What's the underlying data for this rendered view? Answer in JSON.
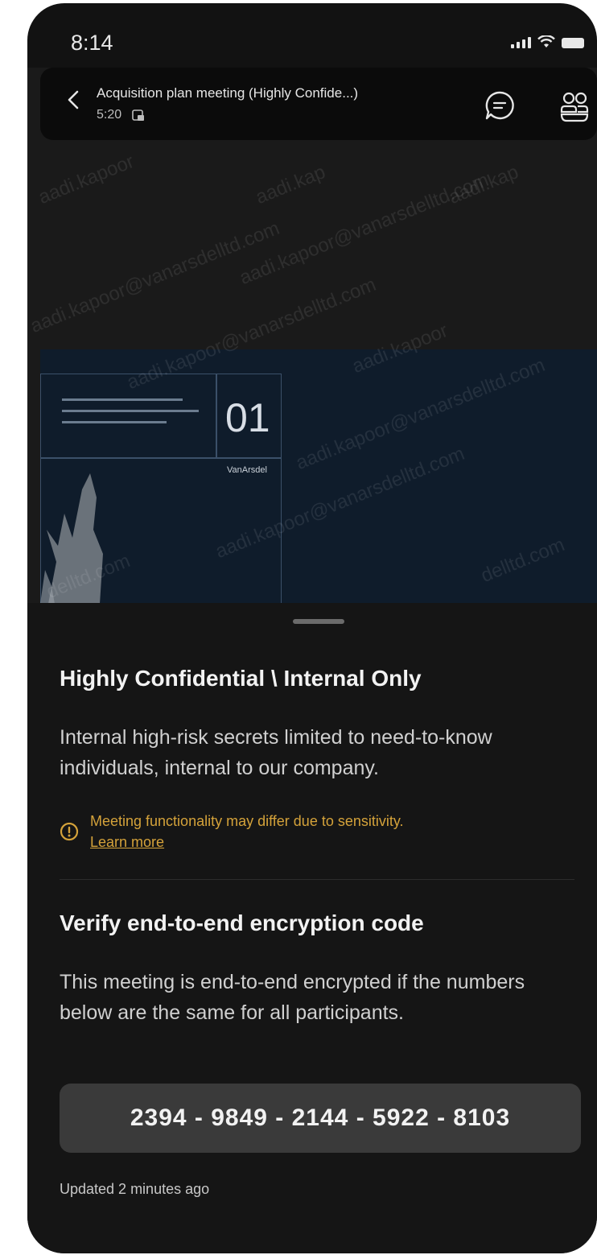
{
  "status": {
    "time": "8:14"
  },
  "header": {
    "title": "Acquisition plan meeting (Highly Confide...)",
    "duration": "5:20"
  },
  "watermark": {
    "email": "aadi.kapoor@vanarsdelltd.com",
    "fragments": [
      "aadi.kapoor",
      "aadi.kap",
      "@vanarsdelltd.com",
      "aadi.kapoor@vanarsdelltd.com",
      "delltd.com"
    ]
  },
  "slide": {
    "number": "01",
    "subtitle": "VanArsdel"
  },
  "sheet": {
    "label_title": "Highly Confidential \\ Internal Only",
    "label_description": "Internal high-risk secrets limited to need-to-know individuals, internal to our company.",
    "warning_text": "Meeting functionality may differ due to sensitivity.",
    "learn_more": "Learn more",
    "e2e_title": "Verify end-to-end encryption code",
    "e2e_description": "This meeting is end-to-end encrypted if the numbers below are the same for all participants.",
    "code": "2394 - 9849 - 2144 - 5922 - 8103",
    "updated": "Updated 2 minutes ago"
  },
  "colors": {
    "background": "#121212",
    "warning": "#d4a23a",
    "slide": "#0f1c2b",
    "codebox": "#3a3a3a"
  }
}
